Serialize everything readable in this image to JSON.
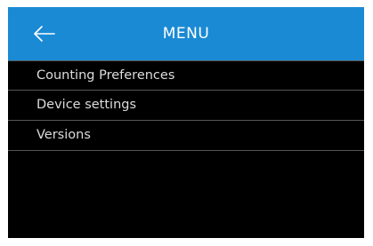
{
  "header": {
    "title": "MENU",
    "back_icon": "arrow-left-icon",
    "color": "#1a8ad4"
  },
  "menu": {
    "items": [
      {
        "label": "Counting Preferences"
      },
      {
        "label": "Device settings"
      },
      {
        "label": "Versions"
      }
    ]
  }
}
